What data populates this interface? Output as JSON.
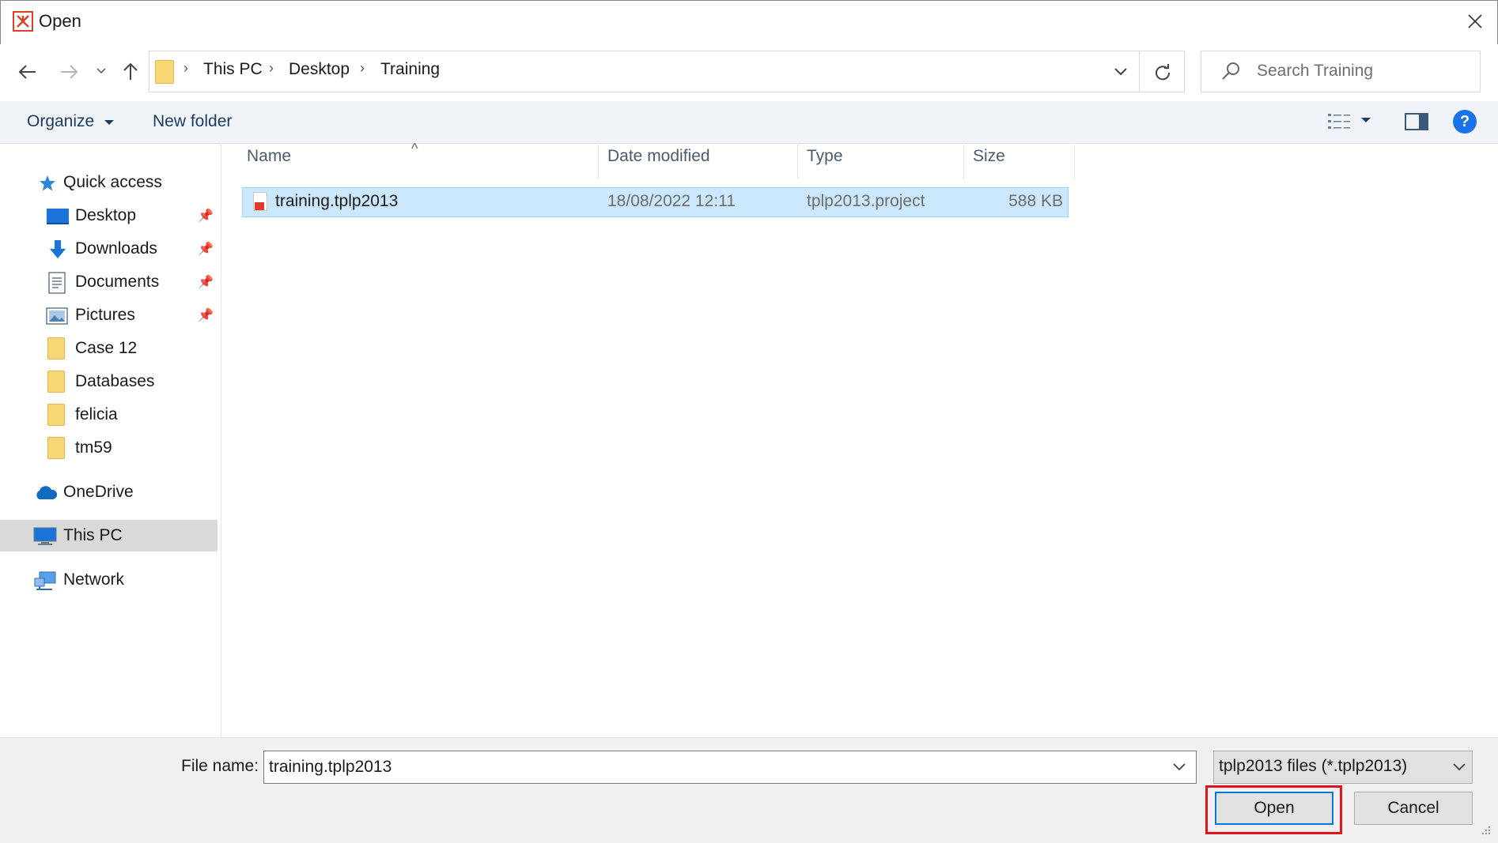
{
  "window": {
    "title": "Open",
    "close_label": "✕"
  },
  "address": {
    "breadcrumbs": [
      "This PC",
      "Desktop",
      "Training"
    ],
    "search_placeholder": "Search Training"
  },
  "toolbar": {
    "organize": "Organize",
    "new_folder": "New folder",
    "help": "?"
  },
  "nav": {
    "quick_access": "Quick access",
    "pinned": [
      "Desktop",
      "Downloads",
      "Documents",
      "Pictures"
    ],
    "folders": [
      "Case 12",
      "Databases",
      "felicia",
      "tm59"
    ],
    "onedrive": "OneDrive",
    "this_pc": "This PC",
    "network": "Network"
  },
  "columns": [
    "Name",
    "Date modified",
    "Type",
    "Size"
  ],
  "files": [
    {
      "name": "training.tplp2013",
      "date": "18/08/2022 12:11",
      "type": "tplp2013.project",
      "size": "588 KB"
    }
  ],
  "bottom": {
    "file_name_label": "File name:",
    "file_name_value": "training.tplp2013",
    "file_type": "tplp2013 files (*.tplp2013)",
    "open": "Open",
    "cancel": "Cancel"
  },
  "colors": {
    "selection": "#cce8ff",
    "accent": "#0078d7",
    "highlight_box": "#e0141e",
    "folder": "#f8d775"
  }
}
